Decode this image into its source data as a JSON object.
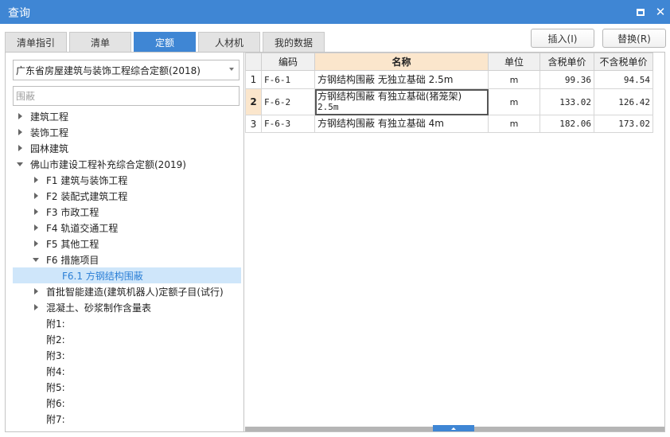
{
  "window": {
    "title": "查询"
  },
  "tabs": [
    {
      "label": "清单指引",
      "active": false
    },
    {
      "label": "清单",
      "active": false
    },
    {
      "label": "定额",
      "active": true
    },
    {
      "label": "人材机",
      "active": false
    },
    {
      "label": "我的数据",
      "active": false
    }
  ],
  "actions": {
    "insert": "插入(I)",
    "replace": "替换(R)"
  },
  "left": {
    "library": "广东省房屋建筑与装饰工程综合定额(2018)",
    "filter_placeholder": "围蔽",
    "tree": [
      {
        "label": "建筑工程",
        "level": 0,
        "arrow": "right"
      },
      {
        "label": "装饰工程",
        "level": 0,
        "arrow": "right"
      },
      {
        "label": "园林建筑",
        "level": 0,
        "arrow": "right"
      },
      {
        "label": "佛山市建设工程补充综合定额(2019)",
        "level": 0,
        "arrow": "down"
      },
      {
        "label": "F1  建筑与装饰工程",
        "level": 1,
        "arrow": "right"
      },
      {
        "label": "F2  装配式建筑工程",
        "level": 1,
        "arrow": "right"
      },
      {
        "label": "F3  市政工程",
        "level": 1,
        "arrow": "right"
      },
      {
        "label": "F4  轨道交通工程",
        "level": 1,
        "arrow": "right"
      },
      {
        "label": "F5  其他工程",
        "level": 1,
        "arrow": "right"
      },
      {
        "label": "F6  措施项目",
        "level": 1,
        "arrow": "down"
      },
      {
        "label": "F6.1  方钢结构围蔽",
        "level": 2,
        "arrow": "none",
        "selected": true
      },
      {
        "label": "首批智能建造(建筑机器人)定额子目(试行)",
        "level": 1,
        "arrow": "right"
      },
      {
        "label": "混凝土、砂浆制作含量表",
        "level": 1,
        "arrow": "right"
      },
      {
        "label": "附1:",
        "level": 1,
        "arrow": "none"
      },
      {
        "label": "附2:",
        "level": 1,
        "arrow": "none"
      },
      {
        "label": "附3:",
        "level": 1,
        "arrow": "none"
      },
      {
        "label": "附4:",
        "level": 1,
        "arrow": "none"
      },
      {
        "label": "附5:",
        "level": 1,
        "arrow": "none"
      },
      {
        "label": "附6:",
        "level": 1,
        "arrow": "none"
      },
      {
        "label": "附7:",
        "level": 1,
        "arrow": "none"
      }
    ]
  },
  "table": {
    "headers": {
      "code": "编码",
      "name": "名称",
      "unit": "单位",
      "price_tax": "含税单价",
      "price_notax": "不含税单价"
    },
    "rows": [
      {
        "index": "1",
        "code": "F-6-1",
        "name": "方钢结构围蔽 无独立基础 2.5m",
        "unit": "m",
        "price_tax": "99.36",
        "price_notax": "94.54"
      },
      {
        "index": "2",
        "code": "F-6-2",
        "name_line1": "方钢结构围蔽 有独立基础(猪笼架)",
        "name_line2": "2.5m",
        "unit": "m",
        "price_tax": "133.02",
        "price_notax": "126.42",
        "selected": true
      },
      {
        "index": "3",
        "code": "F-6-3",
        "name": "方钢结构围蔽 有独立基础 4m",
        "unit": "m",
        "price_tax": "182.06",
        "price_notax": "173.02"
      }
    ]
  }
}
